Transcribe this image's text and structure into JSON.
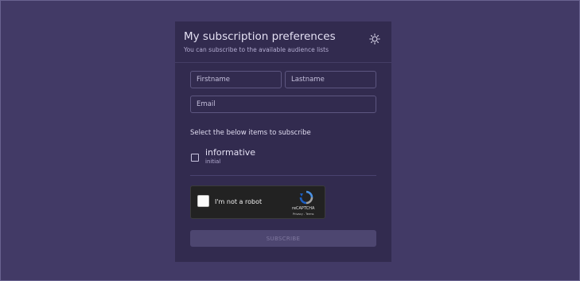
{
  "header": {
    "title": "My subscription preferences",
    "subtitle": "You can subscribe to the available audience lists",
    "theme_icon": "sun-icon"
  },
  "form": {
    "firstname_placeholder": "Firstname",
    "lastname_placeholder": "Lastname",
    "email_placeholder": "Email",
    "section_label": "Select the below items to subscribe",
    "items": [
      {
        "label": "informative",
        "sublabel": "initial",
        "checked": false
      }
    ]
  },
  "recaptcha": {
    "label": "I'm not a robot",
    "brand": "reCAPTCHA",
    "links": "Privacy - Terms"
  },
  "submit": {
    "label": "SUBSCRIBE",
    "disabled": true
  },
  "colors": {
    "page_background": "#423a66",
    "card_background": "#322b4f",
    "button_disabled": "#4d4670"
  }
}
